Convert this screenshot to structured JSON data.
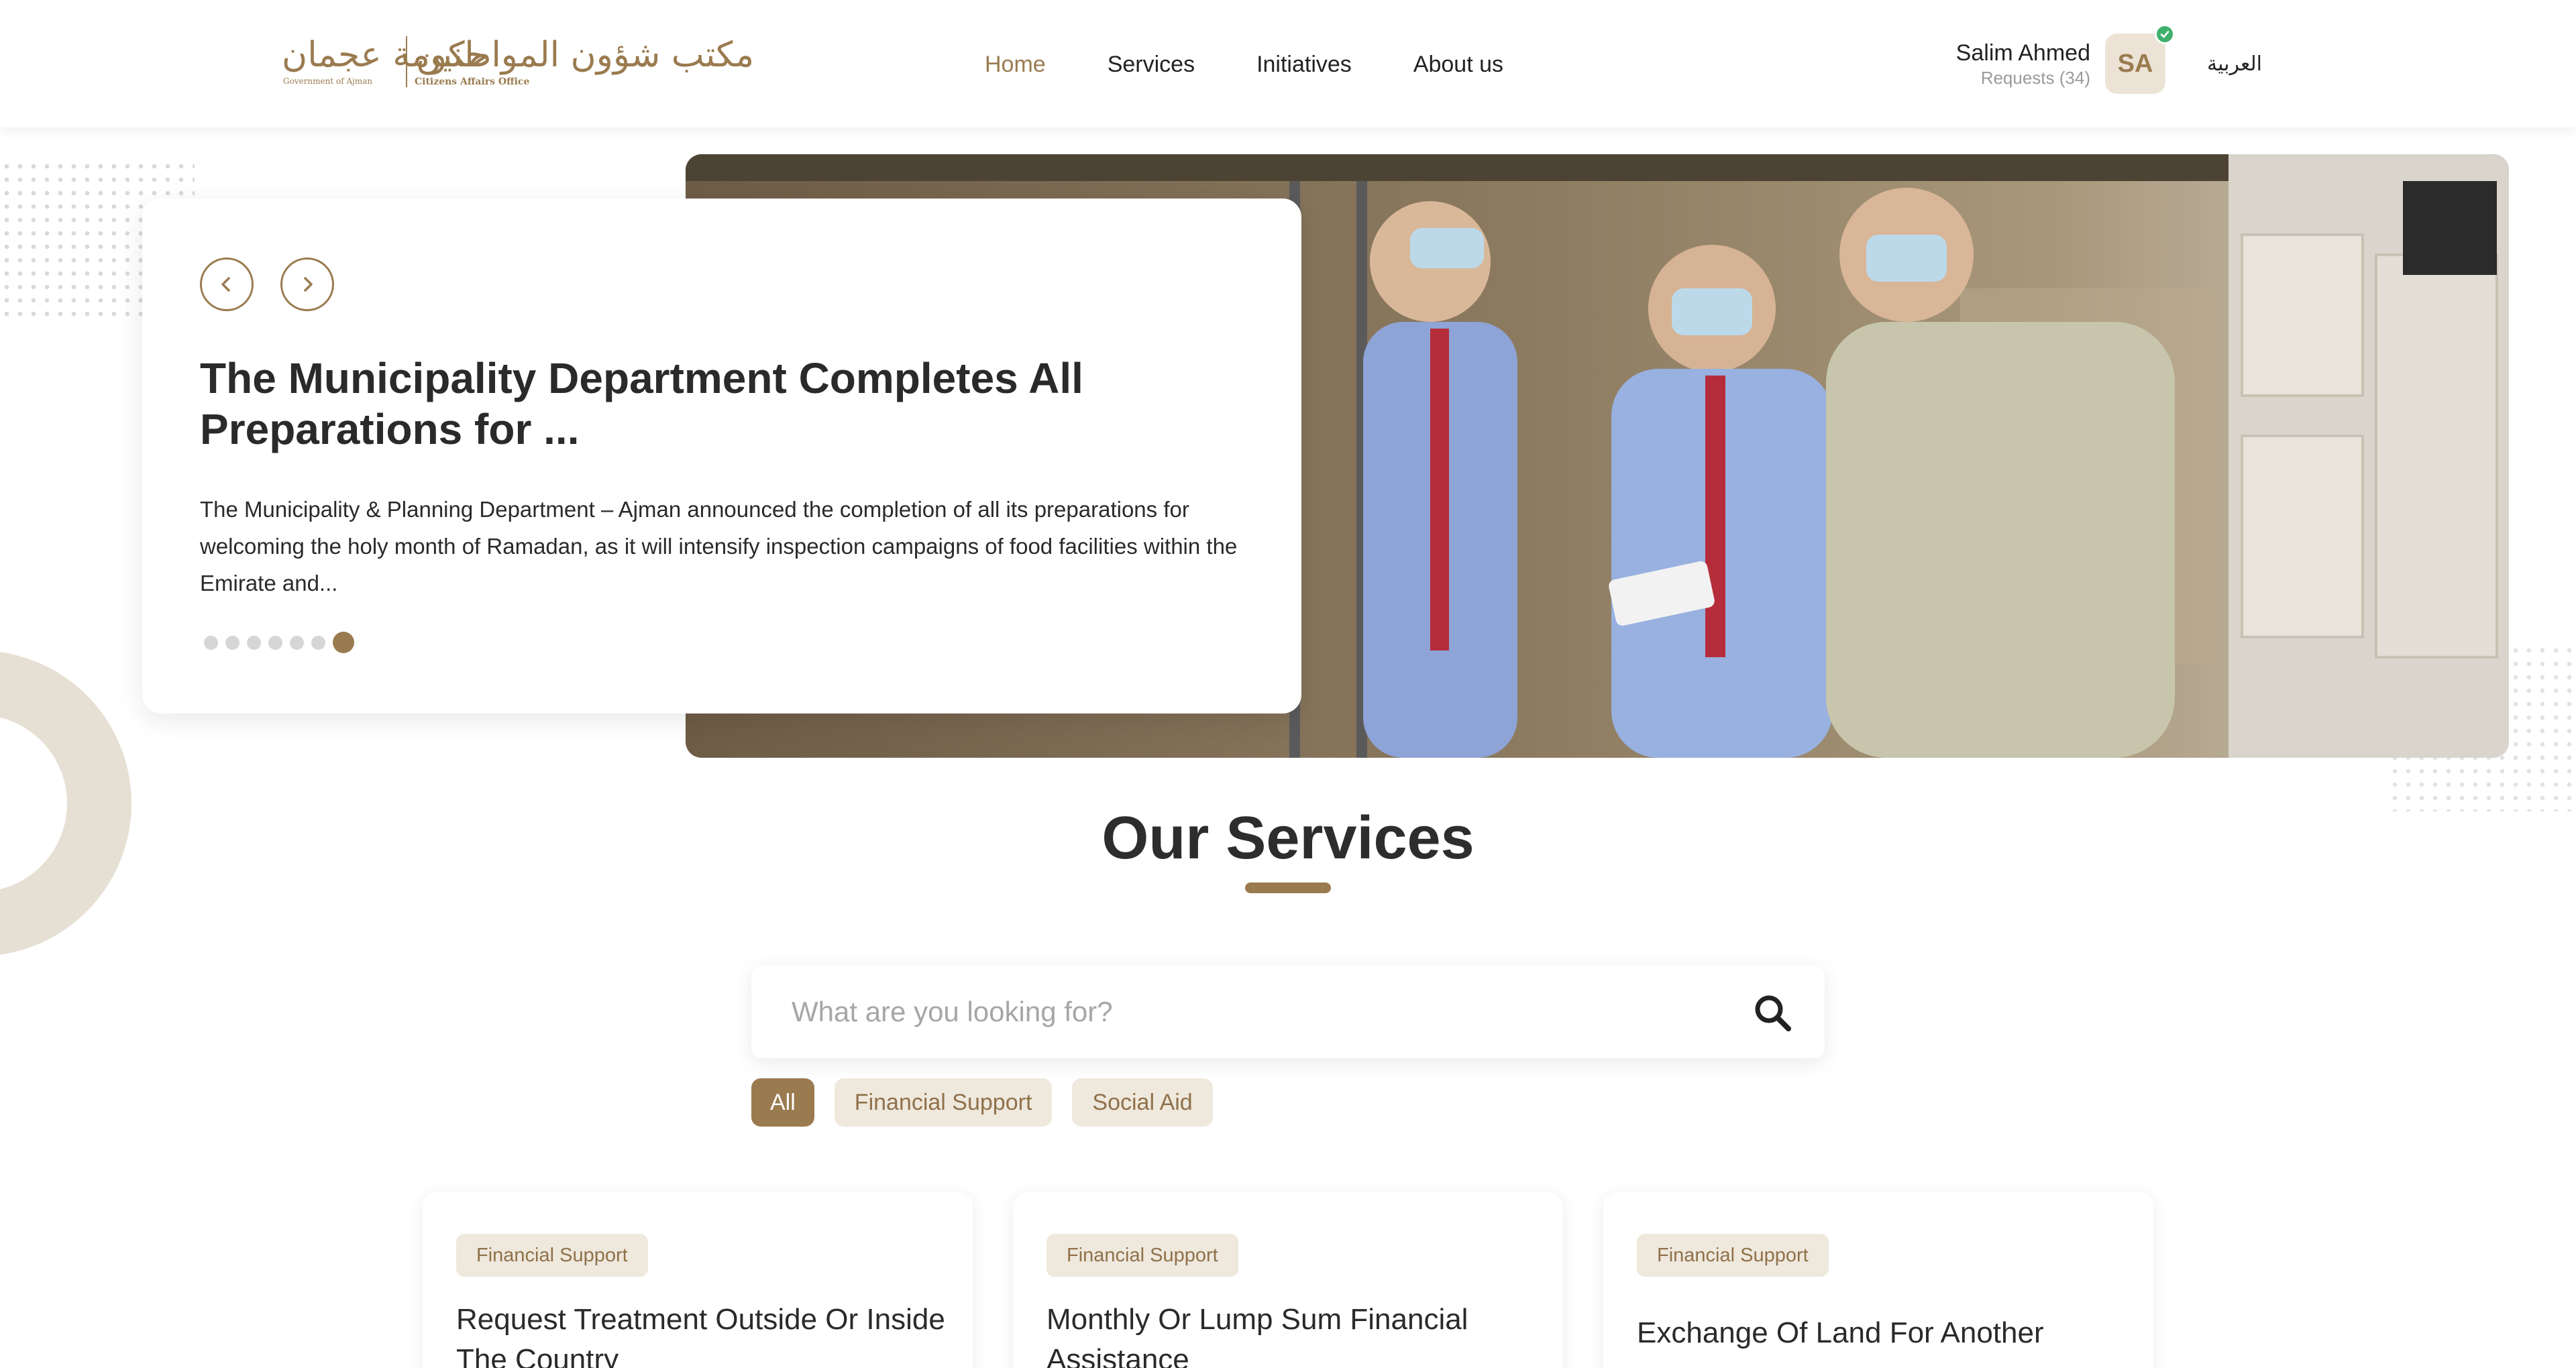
{
  "header": {
    "logo": {
      "arabic_left": "حكومة عجمان",
      "arabic_right": "مكتب شؤون المواطنين",
      "english_left": "Government of Ajman",
      "english_right": "Citizens Affairs Office"
    },
    "nav": [
      "Home",
      "Services",
      "Initiatives",
      "About us"
    ],
    "active_nav": "Home",
    "user": {
      "name": "Salim Ahmed",
      "requests": "Requests (34)",
      "initials": "SA",
      "verified": true
    },
    "language_toggle": "العربية"
  },
  "hero": {
    "title": "The Municipality Department Completes All Preparations for ...",
    "body": "The Municipality & Planning Department – Ajman announced the completion of all its preparations for welcoming the holy month of Ramadan, as it will intensify inspection campaigns of food facilities within the Emirate and...",
    "slide_count": 7,
    "active_slide": 7,
    "prev_icon": "chevron-left-icon",
    "next_icon": "chevron-right-icon"
  },
  "services": {
    "title": "Our Services",
    "search_placeholder": "What are you looking for?",
    "search_icon": "search-icon",
    "filters": [
      "All",
      "Financial Support",
      "Social Aid"
    ],
    "active_filter": "All",
    "cards": [
      {
        "tag": "Financial Support",
        "title": "Request Treatment Outside Or Inside The Country"
      },
      {
        "tag": "Financial Support",
        "title": "Monthly Or Lump Sum Financial Assistance"
      },
      {
        "tag": "Financial Support",
        "title": "Exchange Of Land For Another"
      }
    ]
  },
  "colors": {
    "brand": "#9a7b4f",
    "brand_light": "#efe8dd",
    "verified": "#3fb06b",
    "text": "#222222"
  }
}
